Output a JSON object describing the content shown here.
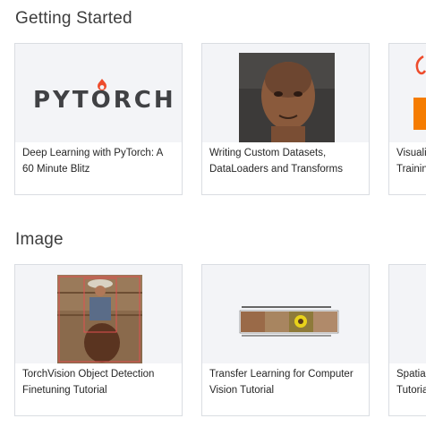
{
  "sections": [
    {
      "title": "Getting Started",
      "cards": [
        {
          "caption": "Deep Learning with PyTorch: A 60 Minute Blitz",
          "logo_text": "PYTORCH"
        },
        {
          "caption": "Writing Custom Datasets, DataLoaders and Transforms"
        },
        {
          "caption_line1": "Visualiz",
          "caption_line2": "Trainin"
        }
      ]
    },
    {
      "title": "Image",
      "cards": [
        {
          "caption": "TorchVision Object Detection Finetuning Tutorial"
        },
        {
          "caption": "Transfer Learning for Computer Vision Tutorial"
        },
        {
          "caption_line1": "Spatial",
          "caption_line2": "Tutoria"
        }
      ]
    }
  ],
  "colors": {
    "pytorch_orange": "#ee4c2c",
    "card_border": "#dadde2",
    "thumb_bg": "#f3f4f7"
  }
}
